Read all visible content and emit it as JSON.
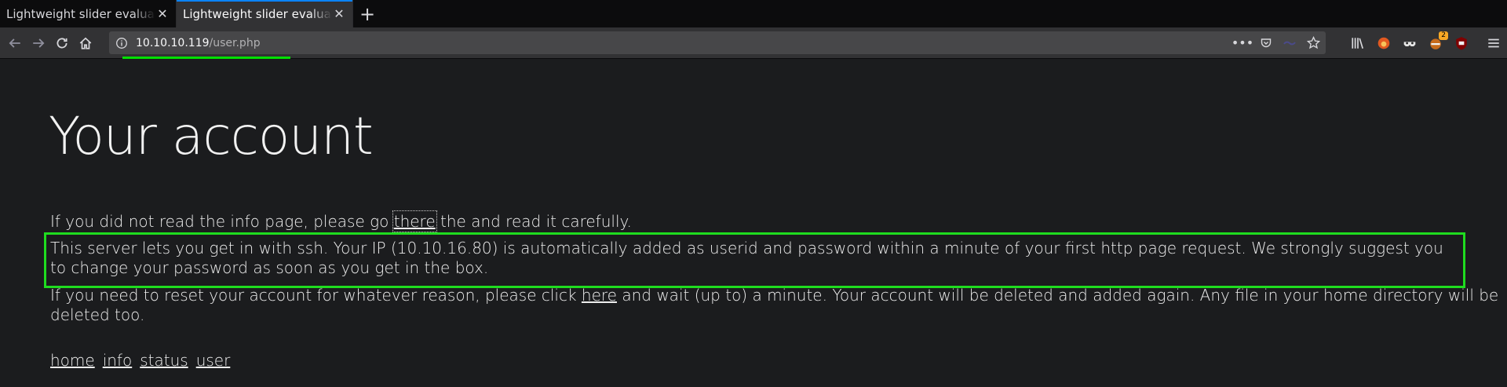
{
  "browser": {
    "tabs": [
      {
        "title": "Lightweight slider evaluation",
        "active": false
      },
      {
        "title": "Lightweight slider evaluation",
        "active": true
      }
    ],
    "url_host": "10.10.10.119",
    "url_path": "/user.php",
    "extension_badge": "2"
  },
  "page": {
    "title": "Your account",
    "p1_before": "If you did not read the info page, please go ",
    "p1_link": "there",
    "p1_after": " the and read it carefully.",
    "p2_text": "This server lets you get in with ssh. Your IP (10.10.16.80) is automatically added as userid and password within a minute of your first http page request. We strongly suggest you to change your password as soon as you get in the box.",
    "p3_before": "If you need to reset your account for whatever reason, please click ",
    "p3_link": "here",
    "p3_after": " and wait (up to) a minute. Your account will be deleted and added again. Any file in your home directory will be deleted too.",
    "nav": [
      "home",
      "info",
      "status",
      "user"
    ]
  },
  "colors": {
    "highlight_box": "#1fdc1f",
    "page_bg": "#1b1c1e",
    "progress": "#00e000"
  }
}
